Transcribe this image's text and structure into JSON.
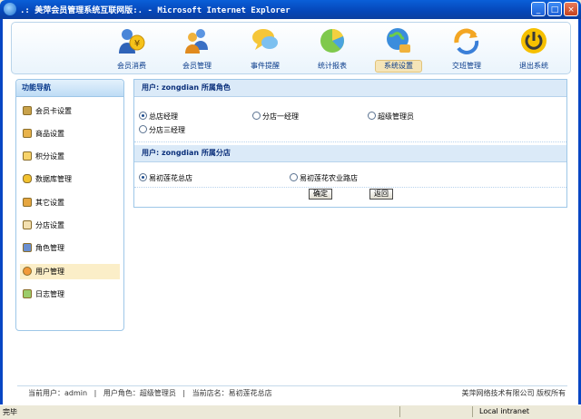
{
  "window": {
    "title": ".: 美萍会员管理系统互联网版:. - Microsoft Internet Explorer",
    "minimize": "_",
    "maximize": "□",
    "close": "×"
  },
  "nav": {
    "items": [
      {
        "label": "会员消费",
        "icon": "coin-person-icon"
      },
      {
        "label": "会员管理",
        "icon": "people-icon"
      },
      {
        "label": "事件提醒",
        "icon": "speech-bubble-icon"
      },
      {
        "label": "统计报表",
        "icon": "pie-chart-icon"
      },
      {
        "label": "系统设置",
        "icon": "settings-globe-icon"
      },
      {
        "label": "交班管理",
        "icon": "refresh-arrow-icon"
      },
      {
        "label": "退出系统",
        "icon": "power-icon"
      }
    ],
    "active": "系统设置"
  },
  "sidebar": {
    "title": "功能导航",
    "items": [
      {
        "label": "会员卡设置"
      },
      {
        "label": "商品设置"
      },
      {
        "label": "积分设置"
      },
      {
        "label": "数据库管理"
      },
      {
        "label": "其它设置"
      },
      {
        "label": "分店设置"
      },
      {
        "label": "角色管理"
      },
      {
        "label": "用户管理"
      },
      {
        "label": "日志管理"
      }
    ],
    "active": "用户管理"
  },
  "main": {
    "roles_header": "用户: zongdian 所属角色",
    "roles": [
      {
        "label": "总店经理",
        "checked": true
      },
      {
        "label": "分店一经理",
        "checked": false
      },
      {
        "label": "超级管理员",
        "checked": false
      },
      {
        "label": "分店三经理",
        "checked": false
      }
    ],
    "stores_header": "用户: zongdian 所属分店",
    "stores": [
      {
        "label": "易初莲花总店",
        "checked": true
      },
      {
        "label": "易初莲花农业路店",
        "checked": false
      }
    ],
    "ok_label": "确定",
    "back_label": "返回"
  },
  "footer": {
    "current_user": "当前用户：admin",
    "user_role": "用户角色：超级管理员",
    "store_name": "当前店名：易初莲花总店",
    "sep1": "|",
    "sep2": "|",
    "copyright": "美萍网络技术有限公司 版权所有"
  },
  "status": {
    "text": "完毕",
    "zone": "Local intranet"
  }
}
